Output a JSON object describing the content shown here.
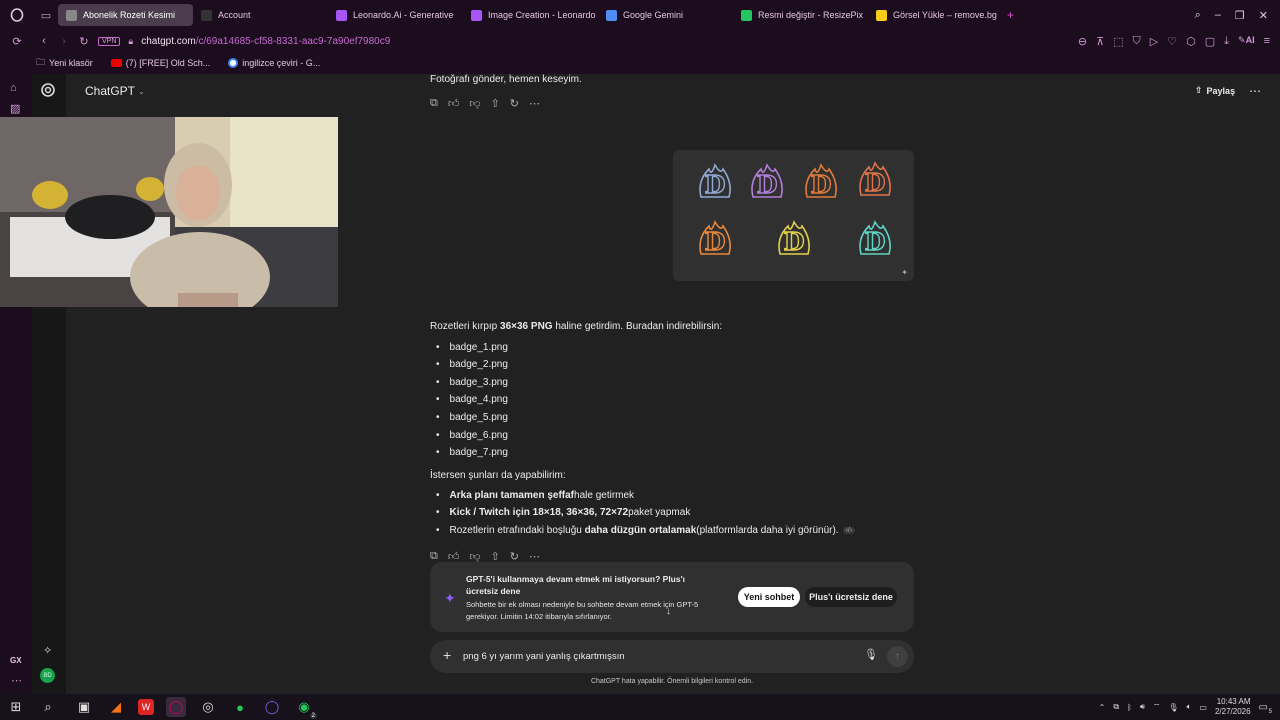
{
  "browser": {
    "tabs": [
      {
        "label": "Abonelik Rozeti Kesimi",
        "color": "#888888",
        "active": true
      },
      {
        "label": "Account",
        "color": "#333333"
      },
      {
        "label": "Leonardo.Ai - Generative",
        "color": "#a855f7"
      },
      {
        "label": "Image Creation - Leonardo",
        "color": "#a855f7"
      },
      {
        "label": "Google Gemini",
        "color": "#4f8df5"
      },
      {
        "label": "Resmi değiştir - ResizePix",
        "color": "#22c55e"
      },
      {
        "label": "Görsel Yükle – remove.bg",
        "color": "#facc15"
      }
    ],
    "vpn_label": "VPN",
    "url_host": "chatgpt.com",
    "url_path": "/c/69a14685-cf58-8331-aac9-7a90ef7980c9",
    "ai_label": "AI",
    "bookmarks": [
      "Yeni klasör",
      "(7) [FREE] Old Sch...",
      "ingilizce çeviri - G..."
    ]
  },
  "gx_label": "GX",
  "avatar_initials": "BD",
  "chatgpt": {
    "model_label": "ChatGPT",
    "share_label": "Paylaş",
    "top_message": "Fotoğrafı gönder, hemen keseyim.",
    "intro_prefix": "Rozetleri kırpıp ",
    "intro_bold": "36×36 PNG",
    "intro_suffix": " haline getirdim. Buradan indirebilirsin:",
    "files": [
      "badge_1.png",
      "badge_2.png",
      "badge_3.png",
      "badge_4.png",
      "badge_5.png",
      "badge_6.png",
      "badge_7.png"
    ],
    "options_heading": "İstersen şunları da yapabilirim:",
    "option1_bold": "Arka planı tamamen şeffaf",
    "option1_rest": " hale getirmek",
    "option2_bold": "Kick / Twitch için 18×18, 36×36, 72×72",
    "option2_rest": " paket yapmak",
    "option3_pre": "Rozetlerin etrafındaki boşluğu ",
    "option3_bold": "daha düzgün ortalamak",
    "option3_rest": " (platformlarda daha iyi görünür).",
    "banner_title": "GPT-5'i kullanmaya devam etmek mi istiyorsun? Plus'ı ücretsiz dene",
    "banner_body": "Sohbette bir ek olması nedeniyle bu sohbete devam etmek için GPT-5 gerekiyor. Limitin 14:02 itibarıyla sıfırlanıyor.",
    "new_chat_label": "Yeni sohbet",
    "plus_label": "Plus'ı ücretsiz dene",
    "composer_text": "png 6 yı yarım yani yanlış çıkartmışsın",
    "disclaimer": "ChatGPT hata yapabilir. Önemli bilgileri kontrol edin."
  },
  "badges": [
    {
      "color": "#8fa9d4"
    },
    {
      "color": "#b27fd6"
    },
    {
      "color": "#e07a3b"
    },
    {
      "color": "#e0724a"
    },
    {
      "color": "#e8883c"
    },
    {
      "color": "#e3d04a"
    },
    {
      "color": "#5fd3c4"
    }
  ],
  "taskbar": {
    "time": "10:43 AM",
    "date": "2/27/2026",
    "whatsapp_count": "2",
    "notification_count": "5"
  },
  "colors": {
    "browser_bg": "#1b0d1e",
    "url_path": "#c86ad0",
    "accent": "#d49bd8"
  }
}
